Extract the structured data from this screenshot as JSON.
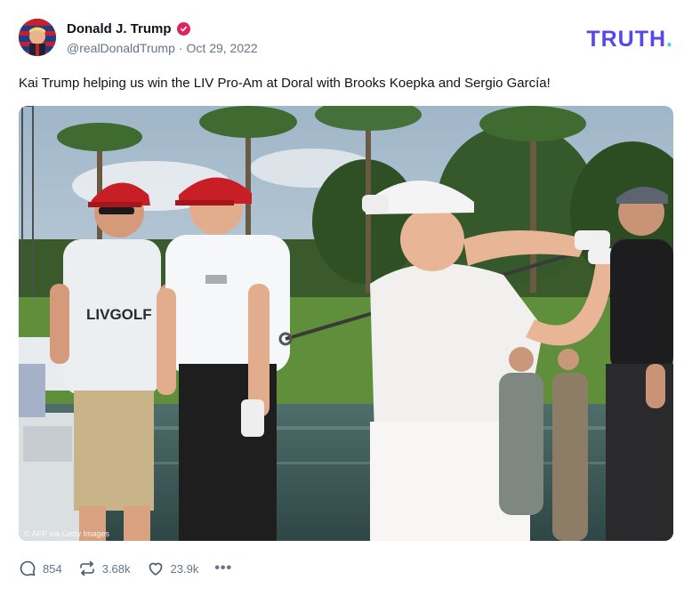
{
  "post": {
    "author": {
      "display_name": "Donald J. Trump",
      "handle": "@realDonaldTrump",
      "separator": "·",
      "date": "Oct 29, 2022",
      "verified_icon": "verified-badge-icon",
      "verified_color": "#e0245e"
    },
    "brand": {
      "name": "TRUTH",
      "dot": ".",
      "color": "#5448ee",
      "dot_color": "#35d3c0"
    },
    "text": "Kai Trump helping us win the LIV Pro-Am at Doral with Brooks Koepka and Sergio García!",
    "media": {
      "credit": "© AFP via Getty Images",
      "cap_text_left": "LIVGOLF"
    },
    "actions": {
      "replies": "854",
      "retruths": "3.68k",
      "likes": "23.9k",
      "more": "•••",
      "icons": [
        "reply-icon",
        "retruth-icon",
        "heart-icon",
        "more-icon"
      ]
    }
  }
}
